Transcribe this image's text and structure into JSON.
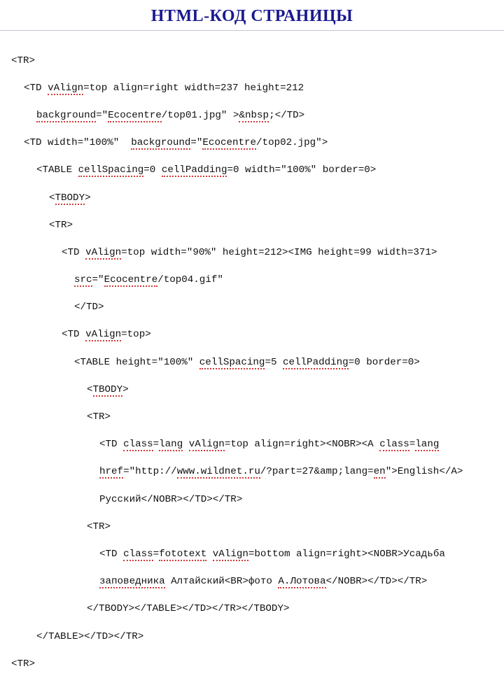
{
  "title": "HTML-КОД СТРАНИЦЫ",
  "code": {
    "l01_a": "<TR>",
    "l02_a": "<TD ",
    "l02_b": "vAlign",
    "l02_c": "=top align=right width=237 height=212",
    "l03_a": "background",
    "l03_b": "=\"",
    "l03_c": "Ecocentre",
    "l03_d": "/top01.jpg\" >",
    "l03_e": "&nbsp",
    "l03_f": ";</TD>",
    "l04_a": "<TD width=\"100%\"  ",
    "l04_b": "background",
    "l04_c": "=\"",
    "l04_d": "Ecocentre",
    "l04_e": "/top02.jpg\">",
    "l05_a": "<TABLE ",
    "l05_b": "cellSpacing",
    "l05_c": "=0 ",
    "l05_d": "cellPadding",
    "l05_e": "=0 width=\"100%\" border=0>",
    "l06_a": "<",
    "l06_b": "TBODY",
    "l06_c": ">",
    "l07_a": "<TR>",
    "l08_a": "<TD ",
    "l08_b": "vAlign",
    "l08_c": "=top width=\"90%\" height=212><IMG height=99 width=371>",
    "l09_a": "src",
    "l09_b": "=\"",
    "l09_c": "Ecocentre",
    "l09_d": "/top04.gif\"",
    "l10_a": "</TD>",
    "l11_a": "<TD ",
    "l11_b": "vAlign",
    "l11_c": "=top>",
    "l12_a": "<TABLE height=\"100%\" ",
    "l12_b": "cellSpacing",
    "l12_c": "=5 ",
    "l12_d": "cellPadding",
    "l12_e": "=0 border=0>",
    "l13_a": "<",
    "l13_b": "TBODY",
    "l13_c": ">",
    "l14_a": "<TR>",
    "l15_a": "<TD ",
    "l15_b": "class",
    "l15_c": "=",
    "l15_d": "lang",
    "l15_e": " ",
    "l15_f": "vAlign",
    "l15_g": "=top align=right><NOBR><A ",
    "l15_h": "class",
    "l15_i": "=",
    "l15_j": "lang",
    "l16_a": "href",
    "l16_b": "=\"http://",
    "l16_c": "www.wildnet.ru",
    "l16_d": "/?part=27&amp;lang=",
    "l16_e": "en",
    "l16_f": "\">English</A>",
    "l17_a": "Русский</NOBR></TD></TR>",
    "l18_a": "<TR>",
    "l19_a": "<TD ",
    "l19_b": "class",
    "l19_c": "=",
    "l19_d": "fototext",
    "l19_e": " ",
    "l19_f": "vAlign",
    "l19_g": "=bottom align=right><NOBR>Усадьба",
    "l20_a": "заповедника",
    "l20_b": " Алтайский<BR>фото ",
    "l20_c": "А.Лотова",
    "l20_d": "</NOBR></TD></TR>",
    "l21_a": "</TBODY></TABLE></TD></TR></TBODY>",
    "l22_a": "</TABLE></TD></TR>",
    "l23_a": "<TR>"
  }
}
